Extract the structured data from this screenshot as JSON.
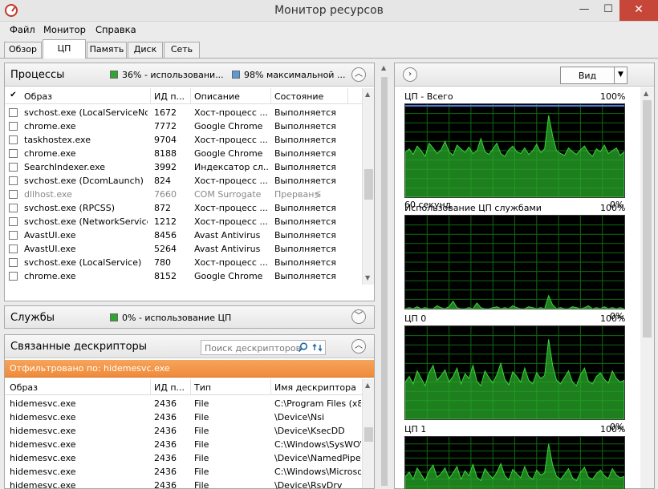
{
  "window": {
    "title": "Монитор ресурсов",
    "minimize": "—",
    "maximize": "☐",
    "close": "✕"
  },
  "menu": [
    "Файл",
    "Монитор",
    "Справка"
  ],
  "tabs": [
    "Обзор",
    "ЦП",
    "Память",
    "Диск",
    "Сеть"
  ],
  "active_tab": "ЦП",
  "processes": {
    "title": "Процессы",
    "cpu_usage": "36% - использовани...",
    "max_freq": "98% максимальной ...",
    "cpu_color": "#2fa62f",
    "freq_color": "#5b9bd5",
    "columns": [
      "Образ",
      "ИД п...",
      "Описание",
      "Состояние"
    ],
    "rows": [
      {
        "image": "svchost.exe (LocalServiceNo...",
        "pid": "1672",
        "desc": "Хост-процесс ...",
        "state": "Выполняется",
        "dim": false
      },
      {
        "image": "chrome.exe",
        "pid": "7772",
        "desc": "Google Chrome",
        "state": "Выполняется",
        "dim": false
      },
      {
        "image": "taskhostex.exe",
        "pid": "9704",
        "desc": "Хост-процесс ...",
        "state": "Выполняется",
        "dim": false
      },
      {
        "image": "chrome.exe",
        "pid": "8188",
        "desc": "Google Chrome",
        "state": "Выполняется",
        "dim": false
      },
      {
        "image": "SearchIndexer.exe",
        "pid": "3992",
        "desc": "Индексатор сл...",
        "state": "Выполняется",
        "dim": false
      },
      {
        "image": "svchost.exe (DcomLaunch)",
        "pid": "824",
        "desc": "Хост-процесс ...",
        "state": "Выполняется",
        "dim": false
      },
      {
        "image": "dllhost.exe",
        "pid": "7660",
        "desc": "COM Surrogate",
        "state": "Прерван≶",
        "dim": true
      },
      {
        "image": "svchost.exe (RPCSS)",
        "pid": "872",
        "desc": "Хост-процесс ...",
        "state": "Выполняется",
        "dim": false
      },
      {
        "image": "svchost.exe (NetworkService)",
        "pid": "1212",
        "desc": "Хост-процесс ...",
        "state": "Выполняется",
        "dim": false
      },
      {
        "image": "AvastUI.exe",
        "pid": "8456",
        "desc": "Avast Antivirus",
        "state": "Выполняется",
        "dim": false
      },
      {
        "image": "AvastUI.exe",
        "pid": "5264",
        "desc": "Avast Antivirus",
        "state": "Выполняется",
        "dim": false
      },
      {
        "image": "svchost.exe (LocalService)",
        "pid": "780",
        "desc": "Хост-процесс ...",
        "state": "Выполняется",
        "dim": false
      },
      {
        "image": "chrome.exe",
        "pid": "8152",
        "desc": "Google Chrome",
        "state": "Выполняется",
        "dim": false
      }
    ]
  },
  "services": {
    "title": "Службы",
    "cpu_usage": "0% - использование ЦП"
  },
  "handles": {
    "title": "Связанные дескрипторы",
    "search_placeholder": "Поиск дескрипторов",
    "filter": "Отфильтровано по: hidemesvc.exe",
    "columns": [
      "Образ",
      "ИД п...",
      "Тип",
      "Имя дескриптора"
    ],
    "rows": [
      {
        "image": "hidemesvc.exe",
        "pid": "2436",
        "type": "File",
        "name": "C:\\Program Files (x86"
      },
      {
        "image": "hidemesvc.exe",
        "pid": "2436",
        "type": "File",
        "name": "\\Device\\Nsi"
      },
      {
        "image": "hidemesvc.exe",
        "pid": "2436",
        "type": "File",
        "name": "\\Device\\KsecDD"
      },
      {
        "image": "hidemesvc.exe",
        "pid": "2436",
        "type": "File",
        "name": "C:\\Windows\\SysWOW"
      },
      {
        "image": "hidemesvc.exe",
        "pid": "2436",
        "type": "File",
        "name": "\\Device\\NamedPipe\\5"
      },
      {
        "image": "hidemesvc.exe",
        "pid": "2436",
        "type": "File",
        "name": "C:\\Windows\\Microso"
      },
      {
        "image": "hidemesvc.exe",
        "pid": "2436",
        "type": "File",
        "name": "\\Device\\RsvDrv"
      }
    ]
  },
  "right": {
    "view_label": "Вид",
    "graphs": [
      {
        "title": "ЦП - Всего",
        "max": "100%",
        "min": "0%",
        "left_footer": "60 секунд",
        "values": [
          48,
          52,
          46,
          55,
          50,
          44,
          58,
          53,
          47,
          51,
          60,
          49,
          45,
          56,
          52,
          48,
          54,
          47,
          50,
          63,
          49,
          46,
          52,
          58,
          47,
          44,
          51,
          55,
          49,
          47,
          53,
          46,
          50,
          57,
          48,
          52,
          88,
          66,
          50,
          47,
          45,
          53,
          49,
          46,
          51,
          55,
          48,
          44,
          52,
          49,
          56,
          47,
          50,
          53,
          45,
          49
        ]
      },
      {
        "title": "Использование ЦП службами",
        "max": "100%",
        "min": "0%",
        "left_footer": "",
        "values": [
          0,
          1,
          0,
          2,
          0,
          1,
          0,
          0,
          3,
          1,
          0,
          2,
          8,
          1,
          0,
          0,
          1,
          0,
          6,
          1,
          0,
          0,
          1,
          2,
          0,
          1,
          0,
          3,
          1,
          0,
          0,
          2,
          1,
          0,
          1,
          0,
          14,
          4,
          0,
          1,
          0,
          0,
          2,
          1,
          0,
          1,
          3,
          0,
          1,
          0,
          2,
          0,
          1,
          0,
          1,
          0
        ]
      },
      {
        "title": "ЦП 0",
        "max": "100%",
        "min": "0%",
        "left_footer": "",
        "values": [
          40,
          46,
          38,
          52,
          44,
          36,
          50,
          58,
          42,
          47,
          53,
          40,
          46,
          55,
          38,
          49,
          44,
          58,
          41,
          36,
          52,
          45,
          39,
          48,
          60,
          43,
          37,
          51,
          46,
          40,
          55,
          42,
          38,
          50,
          44,
          47,
          86,
          58,
          42,
          38,
          45,
          52,
          40,
          36,
          48,
          55,
          41,
          38,
          46,
          50,
          43,
          39,
          52,
          44,
          40,
          42
        ]
      },
      {
        "title": "ЦП 1",
        "max": "100%",
        "min": "",
        "left_footer": "",
        "values": [
          44,
          50,
          40,
          56,
          47,
          38,
          52,
          60,
          43,
          48,
          56,
          41,
          49,
          58,
          40,
          52,
          45,
          61,
          43,
          38,
          55,
          47,
          41,
          50,
          62,
          45,
          39,
          54,
          48,
          42,
          58,
          44,
          40,
          53,
          46,
          49,
          90,
          60,
          44,
          40,
          47,
          55,
          42,
          38,
          50,
          57,
          43,
          40,
          48,
          53,
          45,
          41,
          55,
          46,
          42,
          44
        ]
      }
    ]
  }
}
